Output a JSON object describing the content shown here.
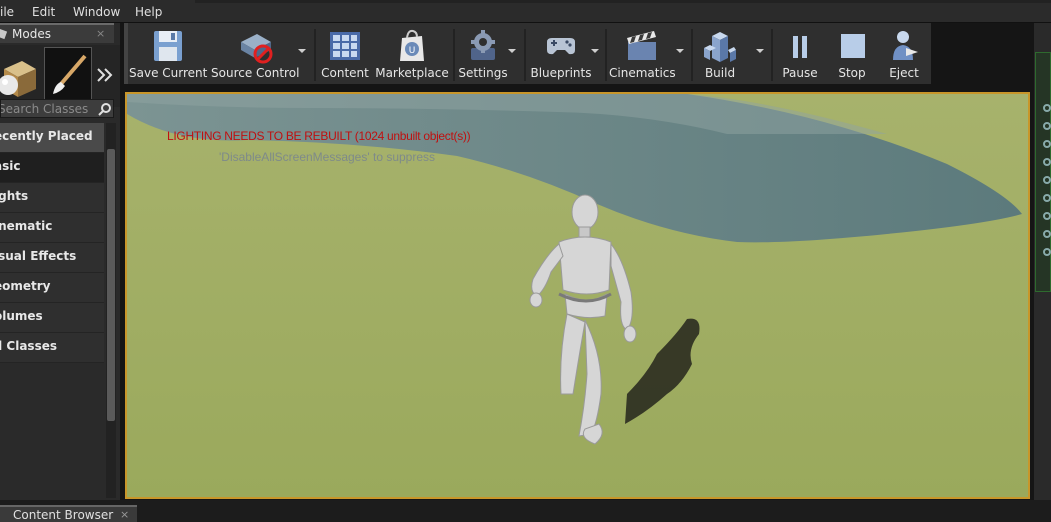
{
  "menu": {
    "file": "ile",
    "edit": "Edit",
    "window": "Window",
    "help": "Help"
  },
  "modes_panel": {
    "title": "Modes",
    "close_glyph": "×",
    "search_placeholder": "Search Classes",
    "categories": [
      "Recently Placed",
      "Basic",
      "Lights",
      "Cinematic",
      "Visual Effects",
      "Geometry",
      "Volumes",
      "All Classes"
    ],
    "category_labels_visible": [
      "ecently Placed",
      "asic",
      "ights",
      "inematic",
      "isual Effects",
      "eometry",
      "olumes",
      "ll Classes"
    ],
    "selected_category": "Basic"
  },
  "toolbar": {
    "save": "Save Current",
    "source_control": "Source Control",
    "content": "Content",
    "marketplace": "Marketplace",
    "settings": "Settings",
    "blueprints": "Blueprints",
    "cinematics": "Cinematics",
    "build": "Build",
    "pause": "Pause",
    "stop": "Stop",
    "eject": "Eject"
  },
  "viewport": {
    "warning": "LIGHTING NEEDS TO BE REBUILT (1024 unbuilt object(s))",
    "hint": "'DisableAllScreenMessages' to suppress"
  },
  "bottom_tab": {
    "title": "Content Browser",
    "close_glyph": "×"
  },
  "colors": {
    "viewport_border": "#c8962a",
    "warning_text": "#c01010"
  },
  "icons": [
    "save-icon",
    "source-control-icon",
    "content-icon",
    "marketplace-icon",
    "settings-icon",
    "blueprints-icon",
    "cinematics-icon",
    "build-icon",
    "pause-icon",
    "stop-icon",
    "eject-icon",
    "search-icon"
  ]
}
